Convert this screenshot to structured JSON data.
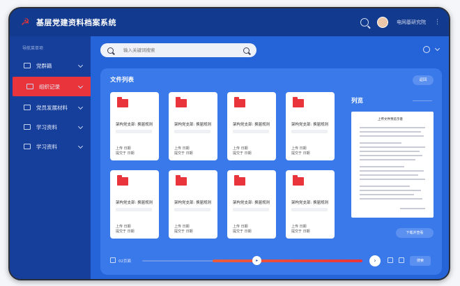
{
  "app": {
    "title": "基层党建资料档案系统",
    "logo_icon": "party-emblem-icon",
    "user_name": "电网基研究院"
  },
  "sidebar": {
    "caption": "导航菜单项",
    "items": [
      {
        "label": "党群籍",
        "icon": "home-icon",
        "active": false
      },
      {
        "label": "组织记录",
        "icon": "folder-icon",
        "active": true
      },
      {
        "label": "党员发展材料",
        "icon": "document-icon",
        "active": false
      },
      {
        "label": "学习资料",
        "icon": "book-icon",
        "active": false
      },
      {
        "label": "学习资料",
        "icon": "play-icon",
        "active": false
      }
    ]
  },
  "search": {
    "placeholder": "输入关键词搜索"
  },
  "file_list": {
    "title": "文件列表",
    "action_label": "返回",
    "files": [
      {
        "name": "架构党支部: 换届规则",
        "meta": "上传 日期\n提交于 日期"
      },
      {
        "name": "架构党支部: 换届规则",
        "meta": "上传 日期\n提交于 日期"
      },
      {
        "name": "架构党支部: 换届规则",
        "meta": "上传 日期\n提交于 日期"
      },
      {
        "name": "架构党支部: 换届规则",
        "meta": "上传 日期\n提交于 日期"
      },
      {
        "name": "架构党支部: 换届规则",
        "meta": "上传 日期\n提交于 日期"
      },
      {
        "name": "架构党支部: 换届规则",
        "meta": "上传 日期\n提交于 日期"
      },
      {
        "name": "架构党支部: 换届规则",
        "meta": "上传 日期\n提交于 日期"
      },
      {
        "name": "架构党支部: 换届规则",
        "meta": "上传 日期\n提交于 日期"
      }
    ]
  },
  "preview": {
    "title": "列览",
    "doc_title": "上传文件预览示意",
    "button_label": "下载并查看"
  },
  "timeline": {
    "label": "02页面",
    "progress": 0.52,
    "button_label": "搜索"
  },
  "colors": {
    "accent": "#e8343a",
    "primary": "#1f4fb5",
    "panel": "#3a79ea"
  }
}
